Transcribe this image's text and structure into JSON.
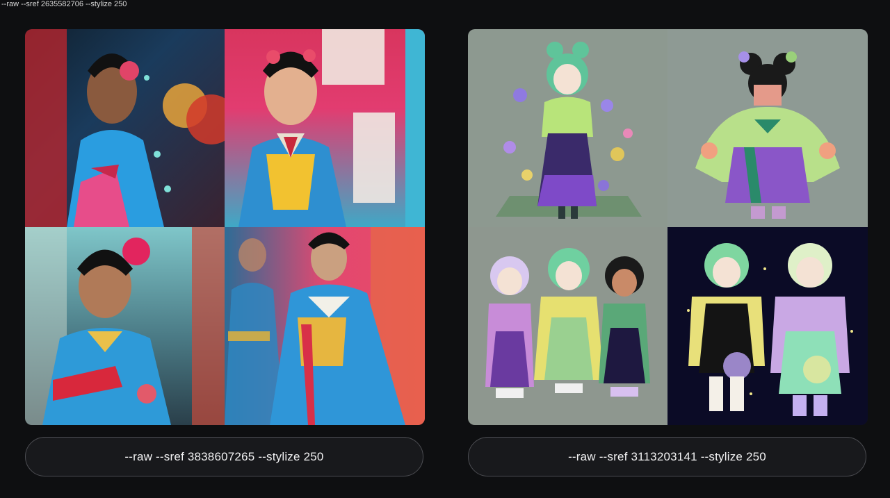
{
  "caption": "--raw --sref 2635582706 --stylize 250",
  "panels": [
    {
      "id": "left",
      "prompt_label": "--raw --sref 3838607265 --stylize 250",
      "tiles": [
        "hanbok-portrait-1",
        "hanbok-portrait-2",
        "hanbok-portrait-3",
        "hanbok-portrait-4"
      ]
    },
    {
      "id": "right",
      "prompt_label": "--raw --sref 3113203141 --stylize 250",
      "tiles": [
        "chibi-hanbok-1",
        "chibi-hanbok-2",
        "chibi-hanbok-3",
        "chibi-hanbok-4"
      ]
    }
  ],
  "colors": {
    "background": "#0e0f11",
    "pill_border": "#4c4d52",
    "pill_fill": "#18191c"
  }
}
